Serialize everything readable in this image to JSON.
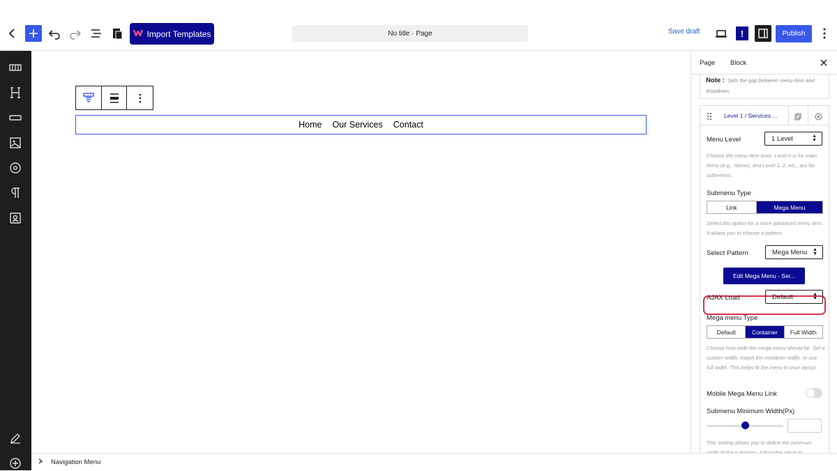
{
  "topbar": {
    "import_label": "Import Templates",
    "doc_title": "No title · Page",
    "save_draft": "Save draft",
    "publish": "Publish",
    "info_mark": "!"
  },
  "canvas": {
    "nav_items": [
      "Home",
      "Our Services",
      "Contact"
    ]
  },
  "footer": {
    "breadcrumb": "Navigation Menu"
  },
  "panel": {
    "tabs": [
      "Page",
      "Block"
    ],
    "note_label": "Note :",
    "note_text": "Sets the gap between menu item and dropdown.",
    "card_title": "Level 1 / Services ...",
    "menu_level_label": "Menu Level",
    "menu_level_value": "1 Level",
    "menu_level_help": "Choose the menu item level. Level 0 is for main items (e.g., Home), and Level 1, 2, etc., are for submenus.",
    "submenu_type_label": "Submenu Type",
    "submenu_type_options": [
      "Link",
      "Mega Menu"
    ],
    "submenu_type_help": "Select this option for a more advanced menu item. It allows you to choose a pattern.",
    "select_pattern_label": "Select Pattern",
    "select_pattern_value": "Mega Menu",
    "edit_button": "Edit Mega Menu - Ser...",
    "ajax_label": "AJAX Load",
    "ajax_value": "Default",
    "mega_type_label": "Mega menu Type",
    "mega_type_options": [
      "Default",
      "Container",
      "Full Width"
    ],
    "mega_type_help": "Choose how wide the mega menu should be. Set a custom width, match the container width, or use full width. This helps fit the menu to your layout.",
    "mobile_link_label": "Mobile Mega Menu Link",
    "min_width_label": "Submenu Minimum Width(Px)",
    "min_width_help": "This setting allows you to define the minimum width of the submenu. Adjust the value to",
    "slider_fraction": 0.5
  },
  "colors": {
    "accent": "#3858e9",
    "brand": "#0b0b92",
    "highlight": "#e0304e",
    "sidebar": "#1e1e1e"
  }
}
